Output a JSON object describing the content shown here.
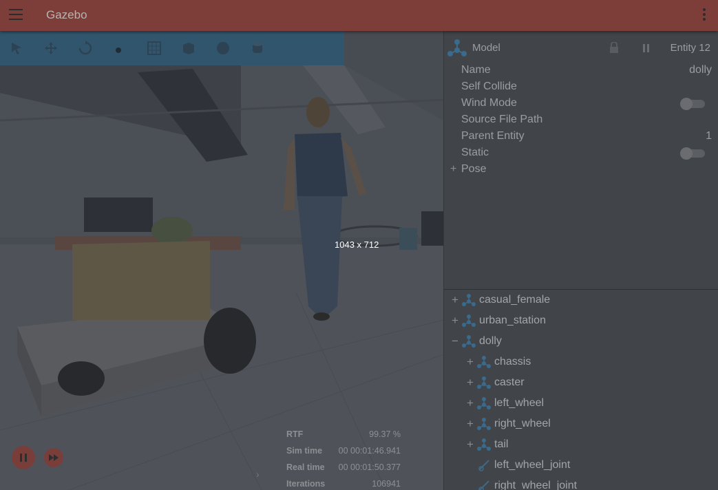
{
  "app": {
    "title": "Gazebo",
    "accent_color": "#7d3d39",
    "menu_icon": "hamburger-icon",
    "overflow_icon": "kebab-menu-icon"
  },
  "toolbar": {
    "tools": [
      {
        "name": "select-tool",
        "icon": "arrow-pointer-icon"
      },
      {
        "name": "translate-tool",
        "icon": "move-arrows-icon"
      },
      {
        "name": "rotate-tool",
        "icon": "rotate-icon"
      },
      {
        "name": "pan-tool",
        "icon": "mouse-icon"
      },
      {
        "name": "grid-tool",
        "icon": "grid-icon"
      },
      {
        "name": "box-shape",
        "icon": "box-icon"
      },
      {
        "name": "sphere-shape",
        "icon": "sphere-icon"
      },
      {
        "name": "cylinder-shape",
        "icon": "cylinder-icon"
      }
    ]
  },
  "viewport": {
    "size_overlay": "1043 x 712",
    "stats": {
      "rtf_label": "RTF",
      "rtf_value": "99.37 %",
      "sim_label": "Sim time",
      "sim_value": "00 00:01:46.941",
      "real_label": "Real time",
      "real_value": "00 00:01:50.377",
      "iter_label": "Iterations",
      "iter_value": "106941"
    },
    "expand_glyph": "›"
  },
  "inspector": {
    "title": "Model",
    "entity": "Entity 12",
    "fields": {
      "name_label": "Name",
      "name_value": "dolly",
      "self_collide_label": "Self Collide",
      "wind_mode_label": "Wind Mode",
      "source_file_label": "Source File Path",
      "parent_label": "Parent Entity",
      "parent_value": "1",
      "static_label": "Static",
      "pose_label": "Pose",
      "pose_toggle": "+"
    }
  },
  "entity_tree": {
    "items": [
      {
        "label": "casual_female",
        "toggle": "+",
        "kind": "model"
      },
      {
        "label": "urban_station",
        "toggle": "+",
        "kind": "model"
      },
      {
        "label": "dolly",
        "toggle": "−",
        "kind": "model"
      },
      {
        "label": "chassis",
        "toggle": "+",
        "kind": "link"
      },
      {
        "label": "caster",
        "toggle": "+",
        "kind": "link"
      },
      {
        "label": "left_wheel",
        "toggle": "+",
        "kind": "link"
      },
      {
        "label": "right_wheel",
        "toggle": "+",
        "kind": "link"
      },
      {
        "label": "tail",
        "toggle": "+",
        "kind": "link"
      },
      {
        "label": "left_wheel_joint",
        "toggle": "",
        "kind": "joint"
      },
      {
        "label": "right_wheel_joint",
        "toggle": "",
        "kind": "joint"
      }
    ]
  }
}
